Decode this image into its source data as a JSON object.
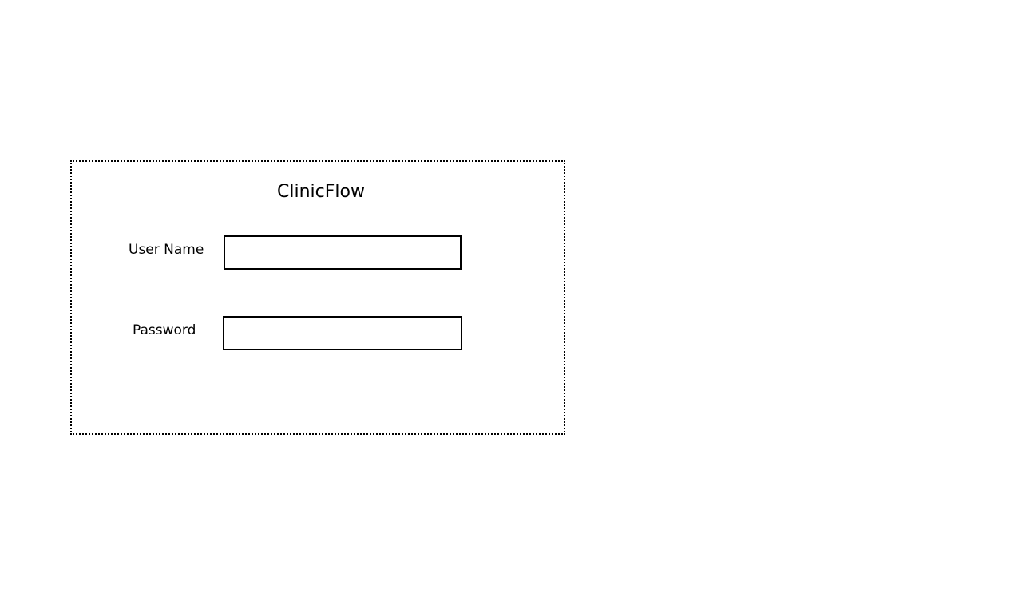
{
  "login": {
    "title": "ClinicFlow",
    "username": {
      "label": "User Name",
      "value": "",
      "placeholder": ""
    },
    "password": {
      "label": "Password",
      "value": "",
      "placeholder": ""
    }
  }
}
